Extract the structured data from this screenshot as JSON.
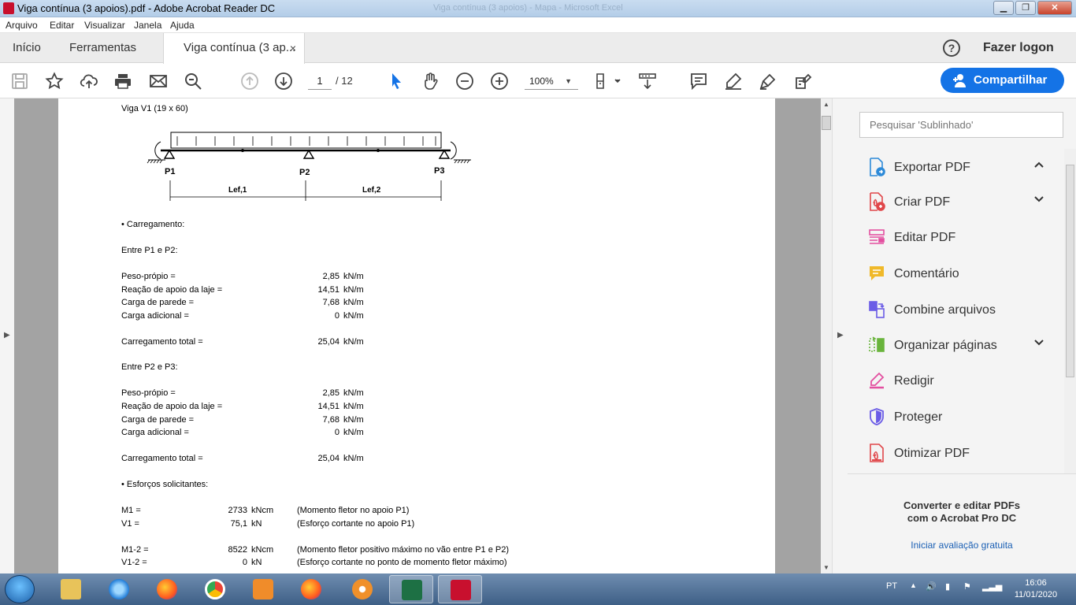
{
  "window": {
    "title": "Viga contínua (3 apoios).pdf - Adobe Acrobat Reader DC",
    "ghost_title": "Viga contínua (3 apoios) - Mapa - Microsoft Excel",
    "minimize": "▁",
    "maximize": "❐",
    "close": "✕"
  },
  "menu": [
    "Arquivo",
    "Editar",
    "Visualizar",
    "Janela",
    "Ajuda"
  ],
  "tabs": {
    "home": "Início",
    "tools": "Ferramentas",
    "doc": "Viga contínua (3 ap...",
    "doc_close": "×"
  },
  "header": {
    "help": "?",
    "login": "Fazer logon"
  },
  "toolbar": {
    "page_current": "1",
    "page_total": "/ 12",
    "zoom": "100%",
    "share": "Compartilhar",
    "icons": [
      "save-icon",
      "bookmark-star-icon",
      "upload-icon",
      "print-icon",
      "email-icon",
      "search-zoom-icon",
      "page-up-icon",
      "page-down-icon",
      "select-cursor-icon",
      "hand-icon",
      "zoom-out-icon",
      "zoom-in-icon",
      "fit-page-icon",
      "scroll-mode-icon",
      "comment-icon",
      "highlight-pen-icon",
      "sign-icon",
      "fill-sign-icon"
    ]
  },
  "document": {
    "heading": "Viga V1 (19 x 60)",
    "diagram": {
      "supports": [
        "P1",
        "P2",
        "P3"
      ],
      "spans": [
        "Lef,1",
        "Lef,2"
      ]
    },
    "section_load": "• Carregamento:",
    "span1_title": "Entre P1 e P2:",
    "span2_title": "Entre P2 e P3:",
    "loads_span1": [
      {
        "label": "Peso-própio =",
        "value": "2,85",
        "unit": "kN/m"
      },
      {
        "label": "Reação de apoio da laje =",
        "value": "14,51",
        "unit": "kN/m"
      },
      {
        "label": "Carga de parede =",
        "value": "7,68",
        "unit": "kN/m"
      },
      {
        "label": "Carga adicional =",
        "value": "0",
        "unit": "kN/m"
      }
    ],
    "total_span1": {
      "label": "Carregamento total =",
      "value": "25,04",
      "unit": "kN/m"
    },
    "loads_span2": [
      {
        "label": "Peso-própio =",
        "value": "2,85",
        "unit": "kN/m"
      },
      {
        "label": "Reação de apoio da laje =",
        "value": "14,51",
        "unit": "kN/m"
      },
      {
        "label": "Carga de parede =",
        "value": "7,68",
        "unit": "kN/m"
      },
      {
        "label": "Carga adicional =",
        "value": "0",
        "unit": "kN/m"
      }
    ],
    "total_span2": {
      "label": "Carregamento total =",
      "value": "25,04",
      "unit": "kN/m"
    },
    "section_efforts": "• Esforços solicitantes:",
    "efforts": [
      {
        "label": "M1 =",
        "value": "2733",
        "unit": "kNcm",
        "desc": "(Momento fletor no apoio P1)"
      },
      {
        "label": "V1 =",
        "value": "75,1",
        "unit": "kN",
        "desc": "(Esforço cortante no apoio P1)"
      },
      {
        "label": "M1-2 =",
        "value": "8522",
        "unit": "kNcm",
        "desc": "(Momento fletor positivo máximo no vão entre P1 e P2)"
      },
      {
        "label": "V1-2 =",
        "value": "0",
        "unit": "kN",
        "desc": "(Esforço cortante no ponto de momento fletor máximo)"
      }
    ]
  },
  "right_pane": {
    "search_placeholder": "Pesquisar 'Sublinhado'",
    "tools": [
      {
        "label": "Exportar PDF",
        "chevron": "up",
        "color": "#2d8ad8"
      },
      {
        "label": "Criar PDF",
        "chevron": "down",
        "color": "#e0474a"
      },
      {
        "label": "Editar PDF",
        "chevron": "",
        "color": "#e34fa0"
      },
      {
        "label": "Comentário",
        "chevron": "",
        "color": "#f0b92a"
      },
      {
        "label": "Combine arquivos",
        "chevron": "",
        "color": "#6b5ce6"
      },
      {
        "label": "Organizar páginas",
        "chevron": "down",
        "color": "#69b43c"
      },
      {
        "label": "Redigir",
        "chevron": "",
        "color": "#e34fa0"
      },
      {
        "label": "Proteger",
        "chevron": "",
        "color": "#6b5ce6"
      },
      {
        "label": "Otimizar PDF",
        "chevron": "",
        "color": "#e0474a"
      }
    ],
    "promo_line1": "Converter e editar PDFs",
    "promo_line2": "com o Acrobat Pro DC",
    "promo_link": "Iniciar avaliação gratuita"
  },
  "taskbar": {
    "apps": [
      "file-explorer-icon",
      "internet-explorer-icon",
      "firefox-icon",
      "chrome-icon",
      "media-player-icon",
      "firefox-dev-icon",
      "settings-gear-icon",
      "excel-icon",
      "acrobat-icon"
    ],
    "language": "PT",
    "time": "16:06",
    "date": "11/01/2020"
  }
}
